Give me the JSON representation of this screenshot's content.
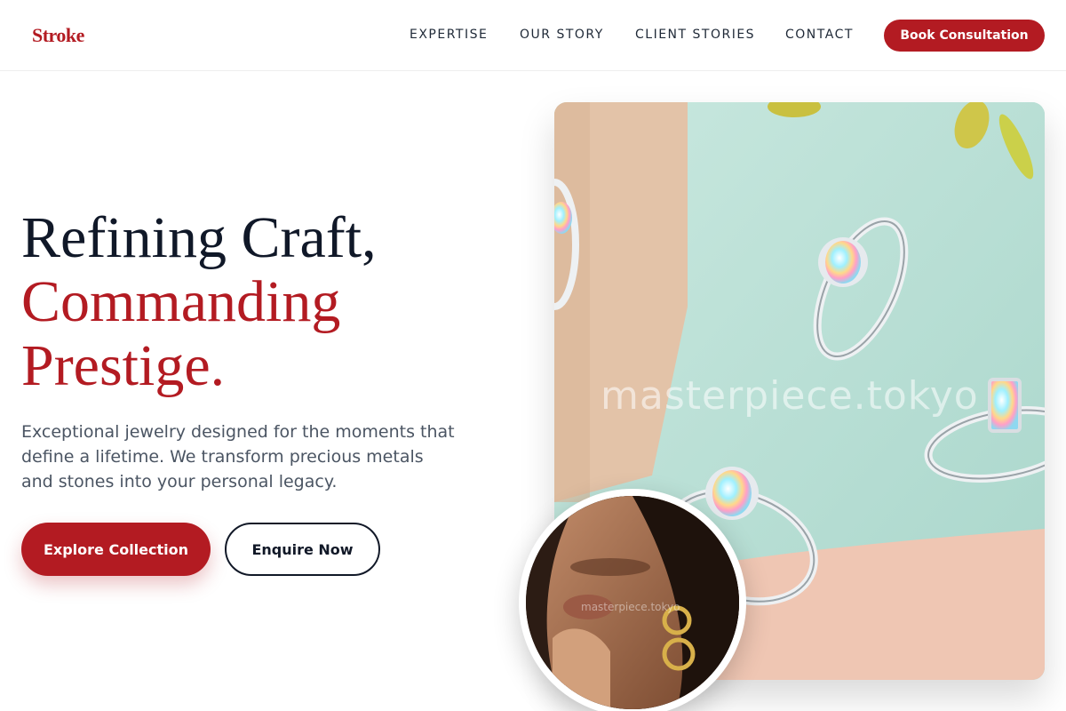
{
  "brand": {
    "logo": "Stroke",
    "accent": "#b31b22"
  },
  "nav": {
    "items": [
      {
        "label": "EXPERTISE"
      },
      {
        "label": "OUR STORY"
      },
      {
        "label": "CLIENT STORIES"
      },
      {
        "label": "CONTACT"
      }
    ],
    "cta_label": "Book Consultation"
  },
  "hero": {
    "title_line1": "Refining Craft,",
    "title_line2": "Commanding",
    "title_line3": "Prestige.",
    "description": "Exceptional jewelry designed for the moments that define a lifetime. We transform precious metals and stones into your personal legacy.",
    "primary_button": "Explore Collection",
    "secondary_button": "Enquire Now"
  },
  "images": {
    "main_watermark": "masterpiece.tokyo",
    "portrait_watermark": "masterpiece.tokyo"
  }
}
